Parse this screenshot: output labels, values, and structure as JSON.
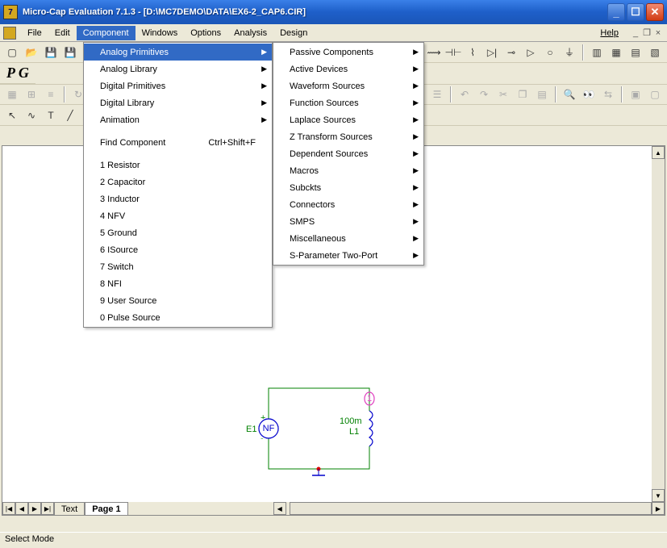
{
  "title": "Micro-Cap Evaluation 7.1.3 - [D:\\MC7DEMO\\DATA\\EX6-2_CAP6.CIR]",
  "menubar": {
    "file": "File",
    "edit": "Edit",
    "component": "Component",
    "windows": "Windows",
    "options": "Options",
    "analysis": "Analysis",
    "design": "Design",
    "help": "Help"
  },
  "pg_label": "P G",
  "menu1": {
    "analog_primitives": "Analog Primitives",
    "analog_library": "Analog Library",
    "digital_primitives": "Digital Primitives",
    "digital_library": "Digital Library",
    "animation": "Animation",
    "find_component": "Find Component",
    "find_shortcut": "Ctrl+Shift+F",
    "r1": "1 Resistor",
    "r2": "2 Capacitor",
    "r3": "3 Inductor",
    "r4": "4 NFV",
    "r5": "5 Ground",
    "r6": "6 ISource",
    "r7": "7 Switch",
    "r8": "8 NFI",
    "r9": "9 User Source",
    "r0": "0 Pulse Source"
  },
  "menu2": {
    "passive": "Passive Components",
    "active": "Active Devices",
    "waveform": "Waveform Sources",
    "function": "Function Sources",
    "laplace": "Laplace Sources",
    "ztrans": "Z Transform Sources",
    "dependent": "Dependent Sources",
    "macros": "Macros",
    "subckts": "Subckts",
    "connectors": "Connectors",
    "smps": "SMPS",
    "misc": "Miscellaneous",
    "sparam": "S-Parameter Two-Port"
  },
  "circuit": {
    "src_label": "E1",
    "src_type": "NF",
    "ind_value": "100m",
    "ind_name": "L1",
    "node": "1"
  },
  "tabs": {
    "text": "Text",
    "page1": "Page 1"
  },
  "status": "Select Mode"
}
